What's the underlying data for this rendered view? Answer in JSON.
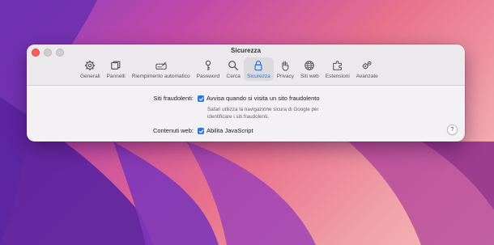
{
  "window": {
    "title": "Sicurezza"
  },
  "toolbar": {
    "items": [
      {
        "label": "Generali",
        "icon": "gear-icon"
      },
      {
        "label": "Pannelli",
        "icon": "tabs-icon"
      },
      {
        "label": "Riempimento automatico",
        "icon": "autofill-icon"
      },
      {
        "label": "Password",
        "icon": "key-icon"
      },
      {
        "label": "Cerca",
        "icon": "search-icon"
      },
      {
        "label": "Sicurezza",
        "icon": "lock-icon",
        "selected": true
      },
      {
        "label": "Privacy",
        "icon": "hand-icon"
      },
      {
        "label": "Siti web",
        "icon": "globe-icon"
      },
      {
        "label": "Estensioni",
        "icon": "extension-icon"
      },
      {
        "label": "Avanzate",
        "icon": "gears-icon"
      }
    ]
  },
  "security": {
    "fraud_label": "Siti fraudolenti:",
    "fraud_checkbox_label": "Avvisa quando si visita un sito fraudolento",
    "fraud_checked": true,
    "fraud_desc_line1": "Safari utilizza la navigazione sicura di Google per",
    "fraud_desc_line2": "identificare i siti fraudolenti.",
    "web_label": "Contenuti web:",
    "js_checkbox_label": "Abilita JavaScript",
    "js_checked": true
  },
  "help": {
    "glyph": "?"
  },
  "colors": {
    "accent": "#2a78e0",
    "close": "#ff5f57"
  }
}
